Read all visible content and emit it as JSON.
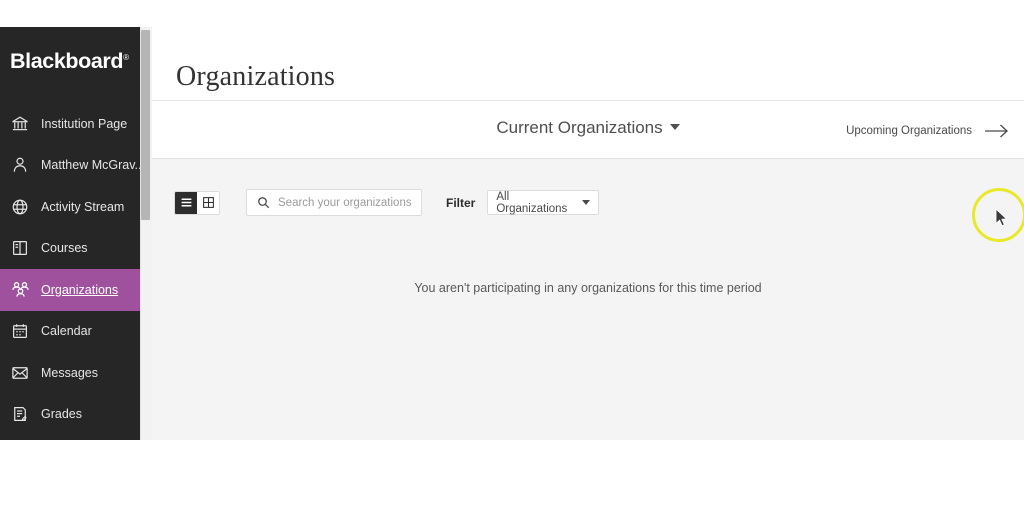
{
  "app": {
    "brand": "Blackboard",
    "brand_tm": "®",
    "accent_color": "#9f519d",
    "sidebar_bg": "#262626",
    "highlight_color": "#e9e929"
  },
  "sidebar": {
    "items": [
      {
        "label": "Institution Page",
        "icon": "institution-icon",
        "active": false
      },
      {
        "label": "Matthew McGrav...",
        "icon": "person-icon",
        "active": false
      },
      {
        "label": "Activity Stream",
        "icon": "globe-icon",
        "active": false
      },
      {
        "label": "Courses",
        "icon": "book-icon",
        "active": false
      },
      {
        "label": "Organizations",
        "icon": "people-group-icon",
        "active": true
      },
      {
        "label": "Calendar",
        "icon": "calendar-icon",
        "active": false
      },
      {
        "label": "Messages",
        "icon": "envelope-icon",
        "active": false
      },
      {
        "label": "Grades",
        "icon": "grades-icon",
        "active": false
      }
    ]
  },
  "main": {
    "page_title": "Organizations",
    "term_bar": {
      "current_label": "Current Organizations",
      "upcoming_label": "Upcoming Organizations"
    },
    "toolbar": {
      "list_view_label": "List view",
      "grid_view_label": "Grid view",
      "search_placeholder": "Search your organizations",
      "search_value": "",
      "filter_label": "Filter",
      "filter_value": "All Organizations"
    },
    "empty_state": "You aren't participating in any organizations for this time period"
  }
}
